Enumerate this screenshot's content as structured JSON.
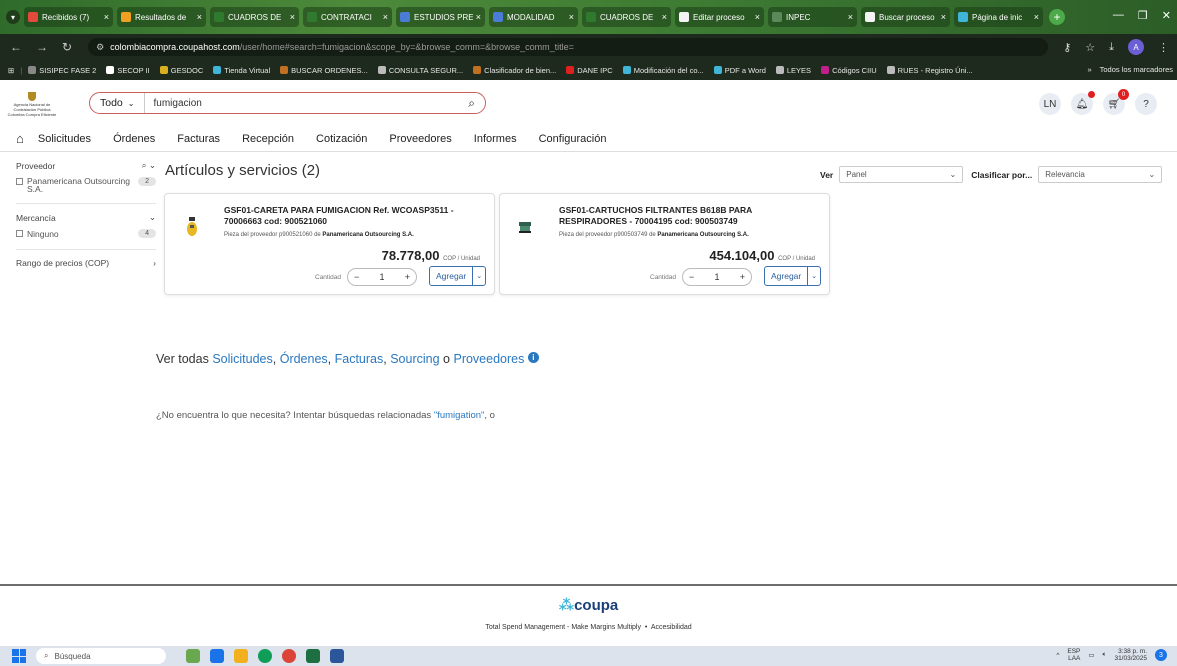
{
  "browser": {
    "tabs": [
      {
        "label": "Recibidos (7)",
        "color": "#e24a3b"
      },
      {
        "label": "Resultados de",
        "color": "#f0a020"
      },
      {
        "label": "CUADROS DE",
        "color": "#2f7a2f"
      },
      {
        "label": "CONTRATACI",
        "color": "#2f7a2f"
      },
      {
        "label": "ESTUDIOS PRE",
        "color": "#4a7bd6"
      },
      {
        "label": "MODALIDAD",
        "color": "#4a7bd6"
      },
      {
        "label": "CUADROS DE",
        "color": "#2f7a2f"
      },
      {
        "label": "Editar proceso",
        "color": "#f4f4f4"
      },
      {
        "label": "INPEC",
        "color": "#5a8a5a"
      },
      {
        "label": "Buscar proceso",
        "color": "#f4f4f4"
      },
      {
        "label": "Página de inic",
        "color": "#3fb6d8"
      }
    ],
    "url_domain": "colombiacompra.coupahost.com",
    "url_rest": "/user/home#search=fumigacion&scope_by=&browse_comm=&browse_comm_title=",
    "profile_initial": "A",
    "bookmarks": [
      {
        "label": "SISIPEC FASE 2",
        "color": "#888888"
      },
      {
        "label": "SECOP II",
        "color": "#ffffff"
      },
      {
        "label": "GESDOC",
        "color": "#d8b020"
      },
      {
        "label": "Tienda Virtual",
        "color": "#3fb6d8"
      },
      {
        "label": "BUSCAR ORDENES...",
        "color": "#c07020"
      },
      {
        "label": "CONSULTA SEGUR...",
        "color": "#bbbbbb"
      },
      {
        "label": "Clasificador de bien...",
        "color": "#c07020"
      },
      {
        "label": "DANE IPC",
        "color": "#e02020"
      },
      {
        "label": "Modificación del co...",
        "color": "#3fb6d8"
      },
      {
        "label": "PDF a Word",
        "color": "#3fb6d8"
      },
      {
        "label": "LEYES",
        "color": "#bbbbbb"
      },
      {
        "label": "Códigos CIIU",
        "color": "#c0208a"
      },
      {
        "label": "RUES - Registro Úni...",
        "color": "#bbbbbb"
      }
    ],
    "all_bookmarks": "Todos los marcadores"
  },
  "app": {
    "logo_text": "Agencia Nacional de Contratación Pública Colombia Compra Eficiente",
    "scope": "Todo",
    "search_value": "fumigacion",
    "user_initials": "LN",
    "cart_count": "0",
    "help": "?",
    "menu": [
      "Solicitudes",
      "Órdenes",
      "Facturas",
      "Recepción",
      "Cotización",
      "Proveedores",
      "Informes",
      "Configuración"
    ]
  },
  "sidebar": {
    "proveedor": "Proveedor",
    "proveedor_option": "Panamericana Outsourcing S.A.",
    "proveedor_count": "2",
    "mercancia": "Mercancía",
    "mercancia_option": "Ninguno",
    "mercancia_count": "4",
    "rango": "Rango de precios (COP)"
  },
  "results": {
    "title": "Artículos y servicios (2)",
    "ver_label": "Ver",
    "ver_value": "Panel",
    "sort_label": "Clasificar por...",
    "sort_value": "Relevancia",
    "items": [
      {
        "title": "GSF01-CARETA PARA FUMIGACION Ref. WCOASP3511 - 70006663 cod: 900521060",
        "sub_prefix": "Pieza del proveedor p900521060 de",
        "supplier": "Panamericana Outsourcing S.A.",
        "price": "78.778,00",
        "unit": "COP / Unidad",
        "qty_label": "Cantidad",
        "qty": "1",
        "add": "Agregar"
      },
      {
        "title": "GSF01-CARTUCHOS FILTRANTES B618B PARA RESPIRADORES - 70004195 cod: 900503749",
        "sub_prefix": "Pieza del proveedor p900503749 de",
        "supplier": "Panamericana Outsourcing S.A.",
        "price": "454.104,00",
        "unit": "COP / Unidad",
        "qty_label": "Cantidad",
        "qty": "1",
        "add": "Agregar"
      }
    ],
    "ver_todas_prefix": "Ver todas",
    "links": [
      "Solicitudes",
      "Órdenes",
      "Facturas",
      "Sourcing"
    ],
    "o": "o",
    "last_link": "Proveedores",
    "noenc_prefix": "¿No encuentra lo que necesita? Intentar búsquedas relacionadas",
    "noenc_link": "\"fumigation\"",
    "noenc_suffix": ", o"
  },
  "footer": {
    "brand": "coupa",
    "tagline": "Total Spend Management - Make Margins Multiply",
    "access": "Accesibilidad"
  },
  "taskbar": {
    "search": "Búsqueda",
    "lang": "ESP",
    "lang2": "LAA",
    "time": "3:38 p. m.",
    "date": "31/03/2025",
    "notif": "3"
  }
}
